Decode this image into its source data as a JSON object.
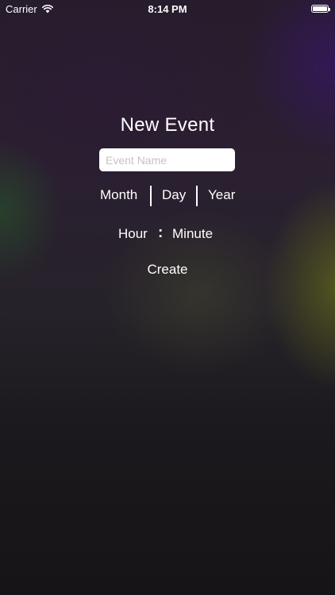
{
  "status_bar": {
    "carrier": "Carrier",
    "time": "8:14 PM",
    "wifi_icon": "wifi-icon",
    "battery_icon": "battery-icon",
    "battery_level": 1.0
  },
  "form": {
    "title": "New Event",
    "event_name": {
      "value": "",
      "placeholder": "Event Name"
    },
    "date": {
      "month_label": "Month",
      "day_label": "Day",
      "year_label": "Year"
    },
    "time": {
      "hour_label": "Hour",
      "separator": ":",
      "minute_label": "Minute"
    },
    "create_label": "Create"
  },
  "colors": {
    "text": "#ffffff",
    "input_background": "#ffffff",
    "placeholder": "#c4c4c8",
    "background_top": "#271c2c",
    "background_bottom": "#161416"
  }
}
